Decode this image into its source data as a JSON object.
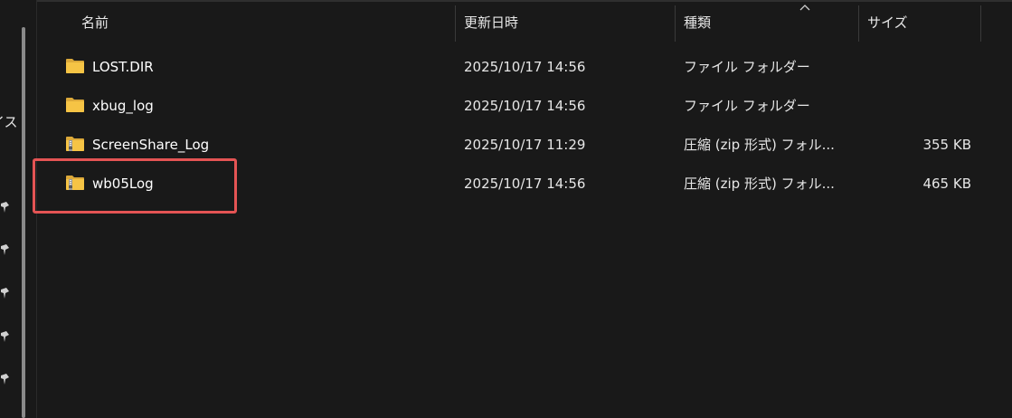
{
  "nav_pane": {
    "partial_text": "イス"
  },
  "columns": {
    "name": "名前",
    "modified": "更新日時",
    "type": "種類",
    "size": "サイズ"
  },
  "files": [
    {
      "name": "LOST.DIR",
      "modified": "2025/10/17 14:56",
      "type": "ファイル フォルダー",
      "size": "",
      "icon": "folder-icon"
    },
    {
      "name": "xbug_log",
      "modified": "2025/10/17 14:56",
      "type": "ファイル フォルダー",
      "size": "",
      "icon": "folder-icon"
    },
    {
      "name": "ScreenShare_Log",
      "modified": "2025/10/17 11:29",
      "type": "圧縮 (zip 形式) フォル...",
      "size": "355 KB",
      "icon": "zip-folder-icon"
    },
    {
      "name": "wb05Log",
      "modified": "2025/10/17 14:56",
      "type": "圧縮 (zip 形式) フォル...",
      "size": "465 KB",
      "icon": "zip-folder-icon"
    }
  ],
  "colors": {
    "background": "#191919",
    "folder": "#f6c445",
    "highlight": "#e45454"
  }
}
